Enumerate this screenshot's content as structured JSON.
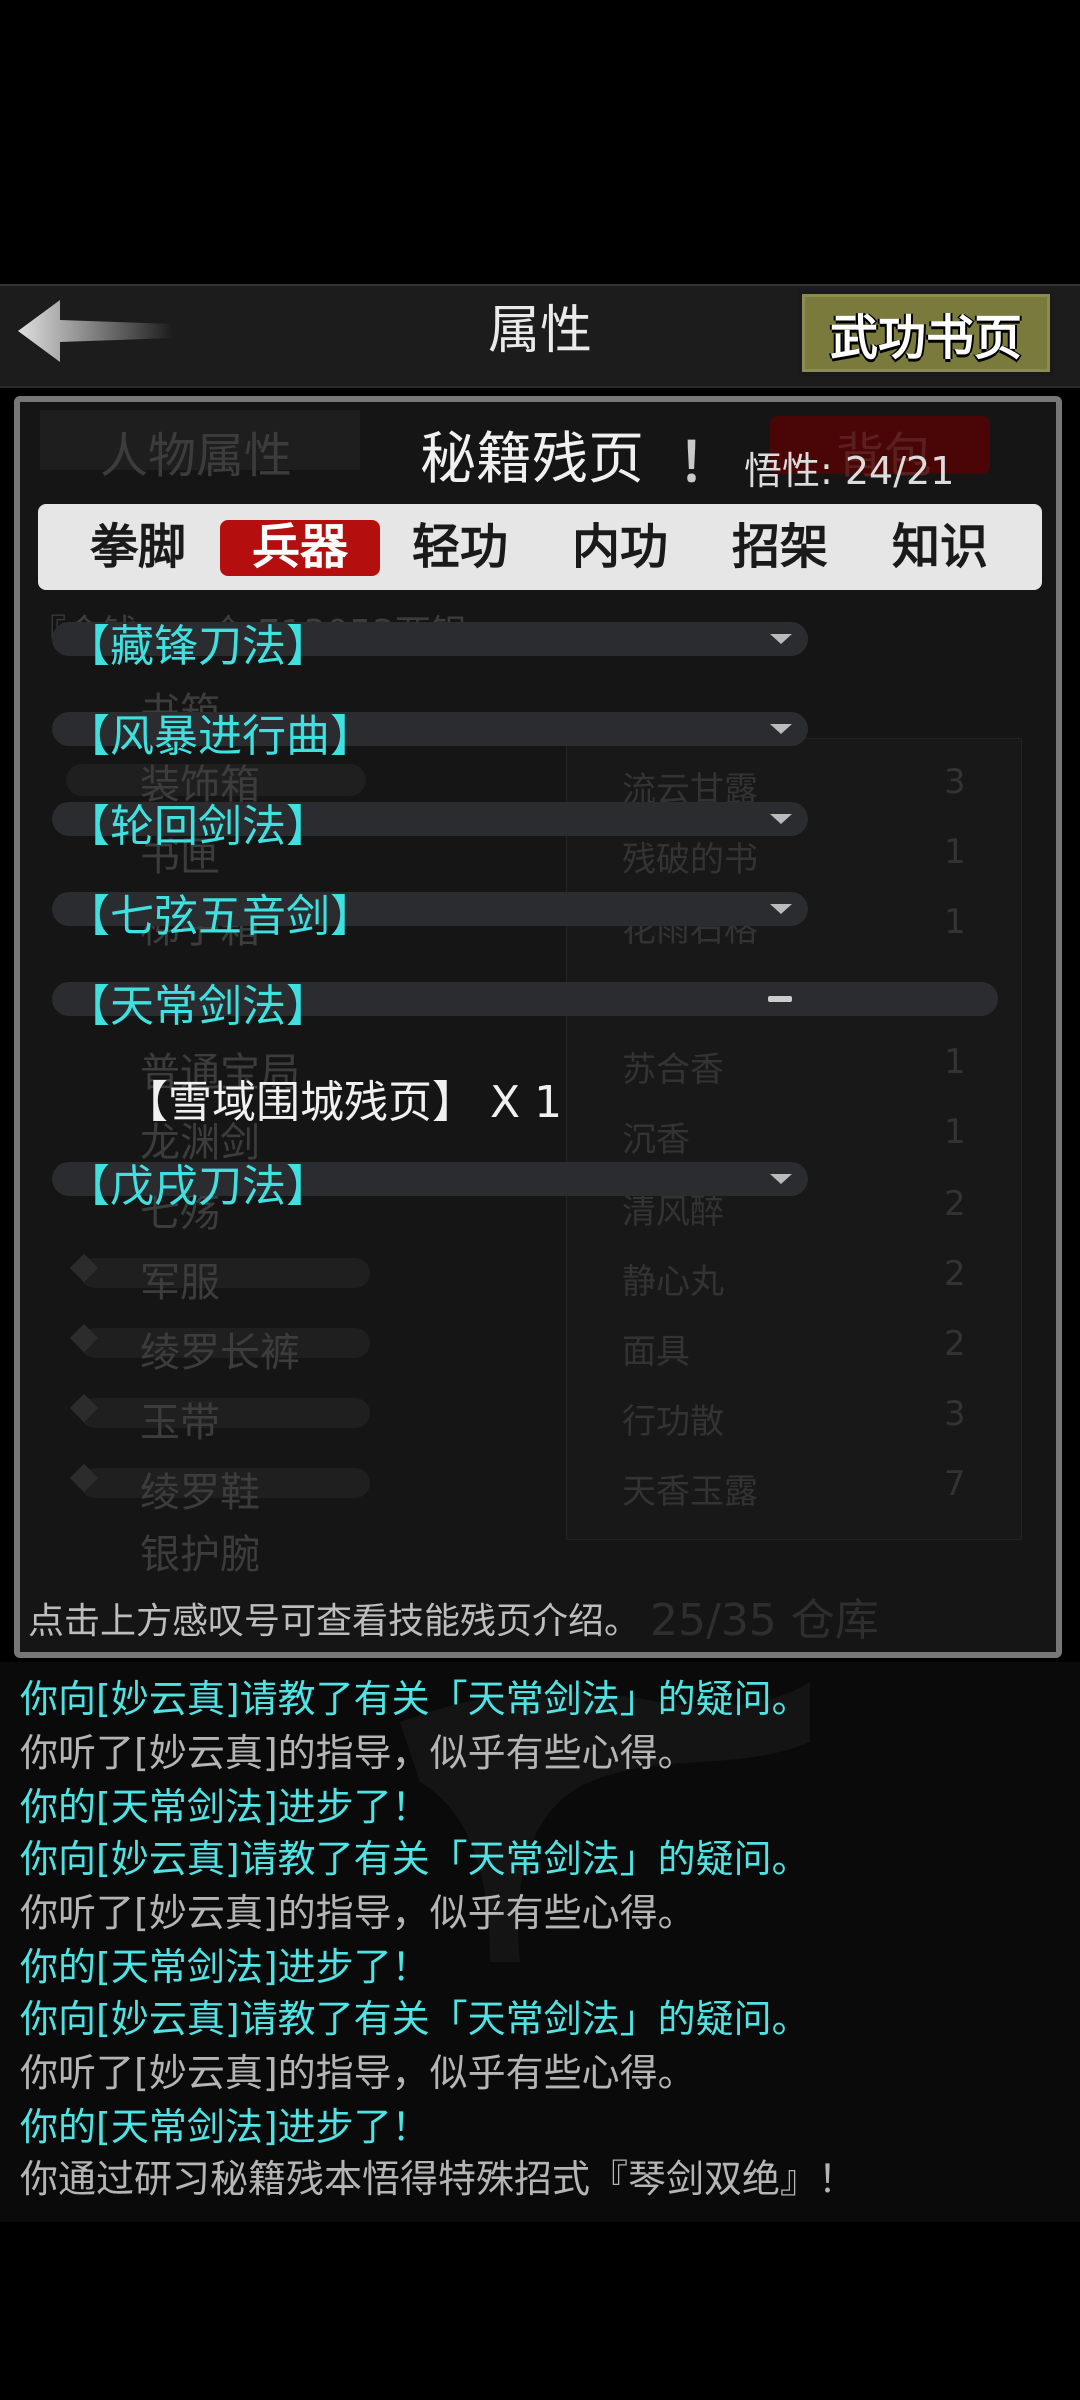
{
  "header": {
    "title": "属性",
    "book_button": "武功书页"
  },
  "background_layer": {
    "tabs_left": "人物属性",
    "tabs_right": "背包",
    "gold_text": "『金钱」…仓 713053两银",
    "left_list": [
      "书箱",
      "装饰箱",
      "书匣",
      "梯子箱",
      "",
      "普通宝局",
      "龙渊剑",
      "七殇",
      "军服",
      "绫罗长裤",
      "玉带",
      "绫罗鞋",
      "银护腕"
    ],
    "right_list": [
      {
        "name": "流云甘露",
        "qty": "3"
      },
      {
        "name": "残破的书",
        "qty": "1"
      },
      {
        "name": "花雨石格",
        "qty": "1"
      },
      {
        "name": "",
        "qty": ""
      },
      {
        "name": "苏合香",
        "qty": "1"
      },
      {
        "name": "沉香",
        "qty": "1"
      },
      {
        "name": "清风醉",
        "qty": "2"
      },
      {
        "name": "静心丸",
        "qty": "2"
      },
      {
        "name": "面具",
        "qty": "2"
      },
      {
        "name": "行功散",
        "qty": "3"
      },
      {
        "name": "天香玉露",
        "qty": "7"
      }
    ],
    "storage": "25/35 仓库"
  },
  "panel": {
    "title": "秘籍残页",
    "excl": "！",
    "insight": "悟性: 24/21",
    "tabs": [
      "拳脚",
      "兵器",
      "轻功",
      "内功",
      "招架",
      "知识"
    ],
    "active_tab": 1,
    "skills": [
      "【藏锋刀法】",
      "【风暴进行曲】",
      "【轮回剑法】",
      "【七弦五音剑】",
      "【天常剑法】",
      "【戊戌刀法】"
    ],
    "expanded_item": "【雪域围城残页】 X 1",
    "hint": "点击上方感叹号可查看技能残页介绍。"
  },
  "log": [
    {
      "text": "你向[妙云真]请教了有关「天常剑法」的疑问。",
      "style": "cyan"
    },
    {
      "text": "你听了[妙云真]的指导，似乎有些心得。",
      "style": "gray"
    },
    {
      "text": "你的[天常剑法]进步了！",
      "style": "cyan"
    },
    {
      "text": "你向[妙云真]请教了有关「天常剑法」的疑问。",
      "style": "cyan"
    },
    {
      "text": "你听了[妙云真]的指导，似乎有些心得。",
      "style": "gray"
    },
    {
      "text": "你的[天常剑法]进步了！",
      "style": "cyan"
    },
    {
      "text": "你向[妙云真]请教了有关「天常剑法」的疑问。",
      "style": "cyan"
    },
    {
      "text": "你听了[妙云真]的指导，似乎有些心得。",
      "style": "gray"
    },
    {
      "text": "你的[天常剑法]进步了！",
      "style": "cyan"
    },
    {
      "text": "你通过研习秘籍残本悟得特殊招式『琴剑双绝』！",
      "style": "gray"
    }
  ],
  "colors": {
    "accent_cyan": "#4fe3e3",
    "active_tab": "#b50e0e",
    "book_button": "#7a7a3c"
  }
}
